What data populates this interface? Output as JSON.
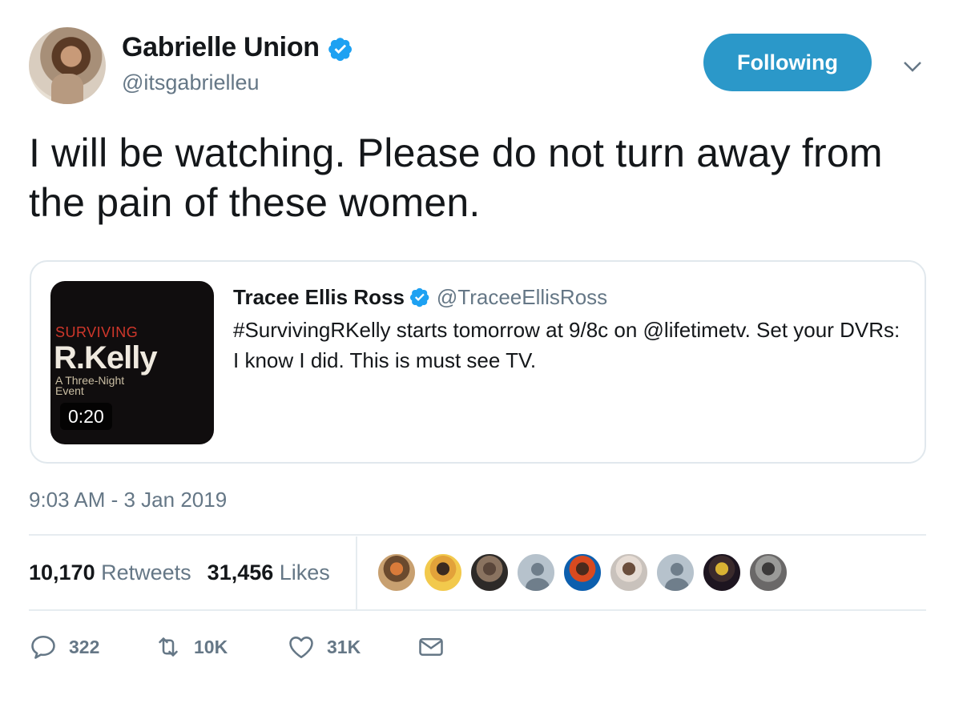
{
  "author": {
    "display_name": "Gabrielle Union",
    "handle": "@itsgabrielleu",
    "verified": true
  },
  "follow_button": {
    "label": "Following"
  },
  "tweet": {
    "text": "I will be watching. Please do not turn away from the pain of these women.",
    "timestamp": "9:03 AM - 3 Jan 2019"
  },
  "quoted_tweet": {
    "display_name": "Tracee Ellis Ross",
    "handle": "@TraceeEllisRoss",
    "verified": true,
    "text": "#SurvivingRKelly starts tomorrow at 9/8c on @lifetimetv. Set your DVRs: I know I did. This is must see TV.",
    "media": {
      "title_line1": "SURVIVING",
      "title_line2": "R.Kelly",
      "subtitle": "A Three-Night Event",
      "duration": "0:20"
    }
  },
  "stats": {
    "retweets_count": "10,170",
    "retweets_label": "Retweets",
    "likes_count": "31,456",
    "likes_label": "Likes"
  },
  "likers": [
    {
      "type": "photo",
      "colors": [
        "#c8a070",
        "#d97b3a",
        "#6b4a2e"
      ]
    },
    {
      "type": "photo",
      "colors": [
        "#f2c94c",
        "#3b2a20",
        "#e2a23a"
      ]
    },
    {
      "type": "photo",
      "colors": [
        "#2d2a28",
        "#5a463a",
        "#8a7360"
      ]
    },
    {
      "type": "default"
    },
    {
      "type": "photo",
      "colors": [
        "#0d5fae",
        "#4a2a1c",
        "#d84a20"
      ]
    },
    {
      "type": "photo",
      "colors": [
        "#c9c2bc",
        "#6b4e3c",
        "#e6dcd4"
      ]
    },
    {
      "type": "default"
    },
    {
      "type": "photo",
      "colors": [
        "#1d1520",
        "#d8b233",
        "#3a2a2c"
      ]
    },
    {
      "type": "photo",
      "colors": [
        "#6a6868",
        "#3c3a3a",
        "#9a9a98"
      ]
    }
  ],
  "actions": {
    "reply_count": "322",
    "retweet_count": "10K",
    "like_count": "31K"
  },
  "icons": {
    "verified": "verified-badge-icon",
    "caret": "chevron-down-icon",
    "reply": "reply-icon",
    "retweet": "retweet-icon",
    "like": "heart-icon",
    "message": "envelope-icon"
  },
  "colors": {
    "accent": "#2b98c9",
    "verified": "#1da1f2",
    "secondary_text": "#657786"
  }
}
